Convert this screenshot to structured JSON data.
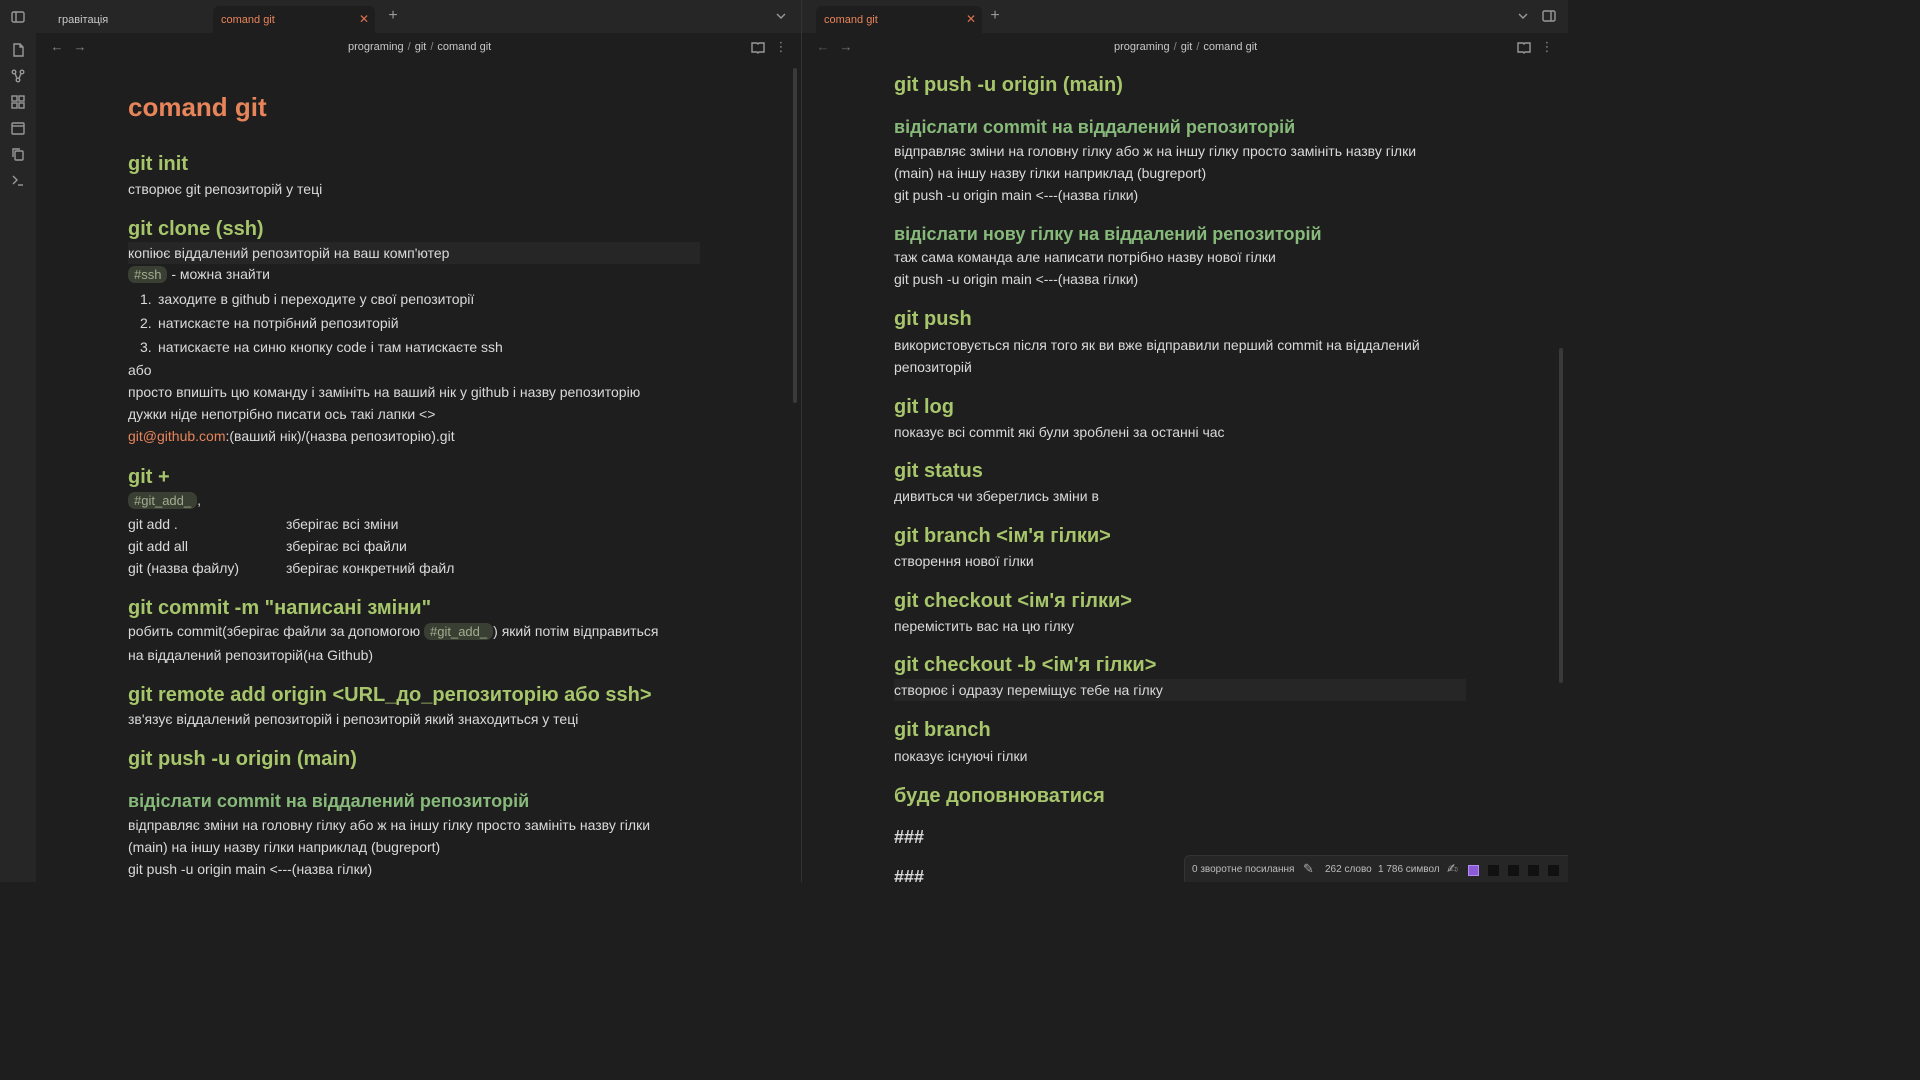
{
  "ribbon": {
    "icons": [
      "panel-toggle-icon",
      "files-icon",
      "graph-icon",
      "canvas-icon",
      "calendar-icon",
      "copy-icon",
      "terminal-icon"
    ]
  },
  "left": {
    "tabs": [
      {
        "label": "гравітація"
      },
      {
        "label": "comand git"
      }
    ],
    "breadcrumb": [
      "programing",
      "git",
      "comand git"
    ],
    "title": "comand git",
    "init": {
      "heading": "git init",
      "desc": "створює git репозиторій у теці"
    },
    "clone": {
      "heading": "git clone (ssh)",
      "desc": "копіює віддалений репозиторій на ваш комп'ютер",
      "tag": "#ssh",
      "tag_after": " - можна знайти",
      "steps": [
        {
          "n": "1.",
          "text": "заходите в github і переходите у свої репозиторії"
        },
        {
          "n": "2.",
          "text": "натискаєте на потрібний репозиторій"
        },
        {
          "n": "3.",
          "text": "натискаєте на синю кнопку code і там натискаєте ssh"
        }
      ],
      "or": "або",
      "line1": "просто впишіть цю команду і замініть на ваший нік у github і назву репозиторію",
      "line2": "дужки ніде непотрібно писати ось такі лапки <>",
      "link": "git@github.com",
      "link_after": ":(ваший нік)/(назва репозиторію).git"
    },
    "add": {
      "heading": "git +",
      "tag": "#git_add_",
      "tag_after": ",",
      "rows": [
        {
          "cmd": "git add .",
          "desc": "зберігає всі зміни"
        },
        {
          "cmd": "git add all",
          "desc": "зберігає всі файли"
        },
        {
          "cmd": "git (назва файлу)",
          "desc": "зберігає конкретний файл"
        }
      ]
    },
    "commit": {
      "heading": "git commit -m \"написані зміни\"",
      "before": "робить commit(зберігає файли за допомогою ",
      "tag": "#git_add_",
      "after": ") який потім відправиться",
      "line2": "на віддалений репозиторій(на Github)"
    },
    "remote": {
      "heading": "git remote add origin <URL_до_репозиторію або ssh>",
      "desc": "зв'язує віддалений репозиторій і репозиторій який знаходиться у теці"
    },
    "push": {
      "heading": "git push -u origin (main)",
      "sub": "відіслати commit на віддалений репозиторій",
      "line1": "відправляє зміни на головну гілку або ж на іншу гілку просто замініть  назву гілки",
      "line2": "(main) на іншу назву гілки наприклад (bugreport)",
      "line3": "git push -u origin main  <---(назва гілки)"
    }
  },
  "right": {
    "tabs": [
      {
        "label": "comand git"
      }
    ],
    "breadcrumb": [
      "programing",
      "git",
      "comand git"
    ],
    "push": {
      "heading": "git push -u origin (main)",
      "sub": "відіслати commit на віддалений репозиторій",
      "line1": "відправляє зміни на головну гілку або ж на іншу гілку просто замініть  назву гілки",
      "line2": "(main) на іншу назву гілки наприклад (bugreport)",
      "line3": "git push -u origin main  <---(назва гілки)"
    },
    "newbranch": {
      "sub": "відіслати нову гілку на віддалений репозиторій",
      "line1": "таж сама команда але написати потрібно назву нової гілки",
      "line2": "git push -u origin main  <---(назва гілки)"
    },
    "gpush": {
      "heading": "git push",
      "line1": "використовується після того як ви вже відправили перший commit на віддалений",
      "line2": "репозиторій"
    },
    "log": {
      "heading": "git log",
      "desc": "показує всі commit які були зроблені за останні час"
    },
    "status": {
      "heading": "git status",
      "desc": "дивиться чи зберeглись зміни в"
    },
    "branch_new": {
      "heading": "git branch <ім'я гілки>",
      "desc": "створення нової гілки"
    },
    "checkout": {
      "heading": "git checkout <ім'я гілки>",
      "desc": "перемістить вас на цю гілку"
    },
    "checkout_b": {
      "heading": "git checkout -b <ім'я гілки>",
      "desc": "створює і одразу переміщує тебе на гілку"
    },
    "branch": {
      "heading": "git branch",
      "desc": "показує існуючі гілки"
    },
    "more": {
      "heading": "буде доповнюватися"
    },
    "hash1": "###",
    "hash2": "###"
  },
  "statusbar": {
    "backlinks": "0 зворотне посилання",
    "words": "262 слово",
    "chars": "1 786 символ"
  },
  "colors": {
    "accent": "#e8845a",
    "heading": "#a7c66b",
    "subheading": "#86b97a",
    "background": "#1e1e1e"
  }
}
